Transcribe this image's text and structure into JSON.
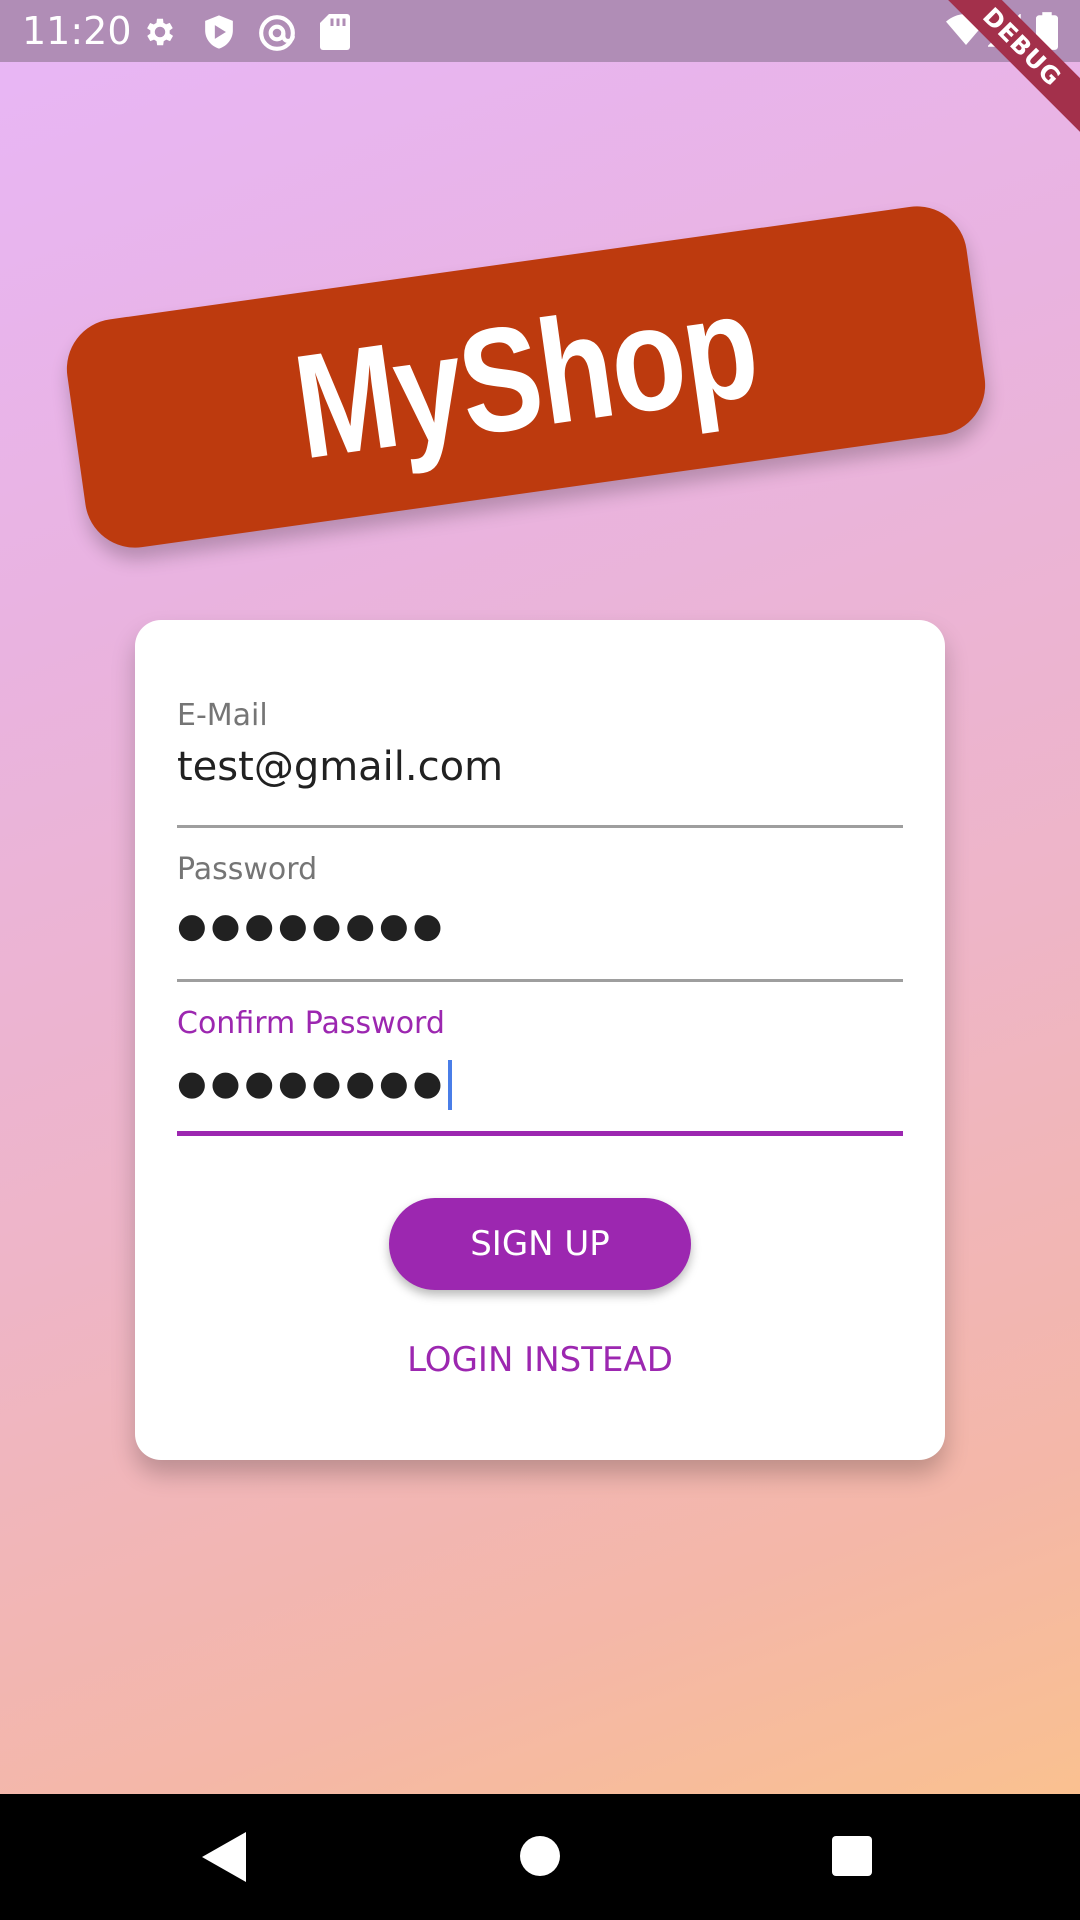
{
  "status_bar": {
    "time": "11:20",
    "icons": [
      "settings-icon",
      "shield-play-icon",
      "at-sign-icon",
      "sd-card-icon",
      "wifi-icon",
      "signal-icon",
      "battery-icon"
    ]
  },
  "debug_banner": "DEBUG",
  "logo": {
    "text": "MyShop",
    "badge_color": "#bd3a0e"
  },
  "form": {
    "email": {
      "label": "E-Mail",
      "value": "test@gmail.com"
    },
    "password": {
      "label": "Password",
      "value": "●●●●●●●●"
    },
    "confirm_password": {
      "label": "Confirm Password",
      "value": "●●●●●●●●"
    },
    "signup_label": "SIGN UP",
    "login_instead_label": "LOGIN INSTEAD"
  },
  "colors": {
    "accent": "#9c27b0",
    "cursor": "#4a7ee8"
  },
  "nav_bar": {
    "buttons": [
      "back-icon",
      "home-icon",
      "recents-icon"
    ]
  }
}
